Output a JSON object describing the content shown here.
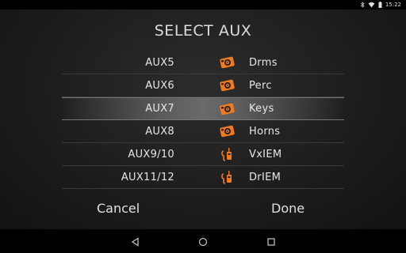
{
  "status": {
    "time": "15:22"
  },
  "title": "SELECT AUX",
  "items": [
    {
      "aux": "AUX5",
      "label": "Drms",
      "icon": "speaker-icon",
      "selected": false
    },
    {
      "aux": "AUX6",
      "label": "Perc",
      "icon": "speaker-icon",
      "selected": false
    },
    {
      "aux": "AUX7",
      "label": "Keys",
      "icon": "speaker-icon",
      "selected": true
    },
    {
      "aux": "AUX8",
      "label": "Horns",
      "icon": "speaker-icon",
      "selected": false
    },
    {
      "aux": "AUX9/10",
      "label": "VxIEM",
      "icon": "iem-icon",
      "selected": false
    },
    {
      "aux": "AUX11/12",
      "label": "DrIEM",
      "icon": "iem-icon",
      "selected": false
    }
  ],
  "buttons": {
    "cancel": "Cancel",
    "done": "Done"
  },
  "colors": {
    "accent": "#f07a1e",
    "background": "#1d1d1d",
    "divider": "#3a3a3a"
  }
}
